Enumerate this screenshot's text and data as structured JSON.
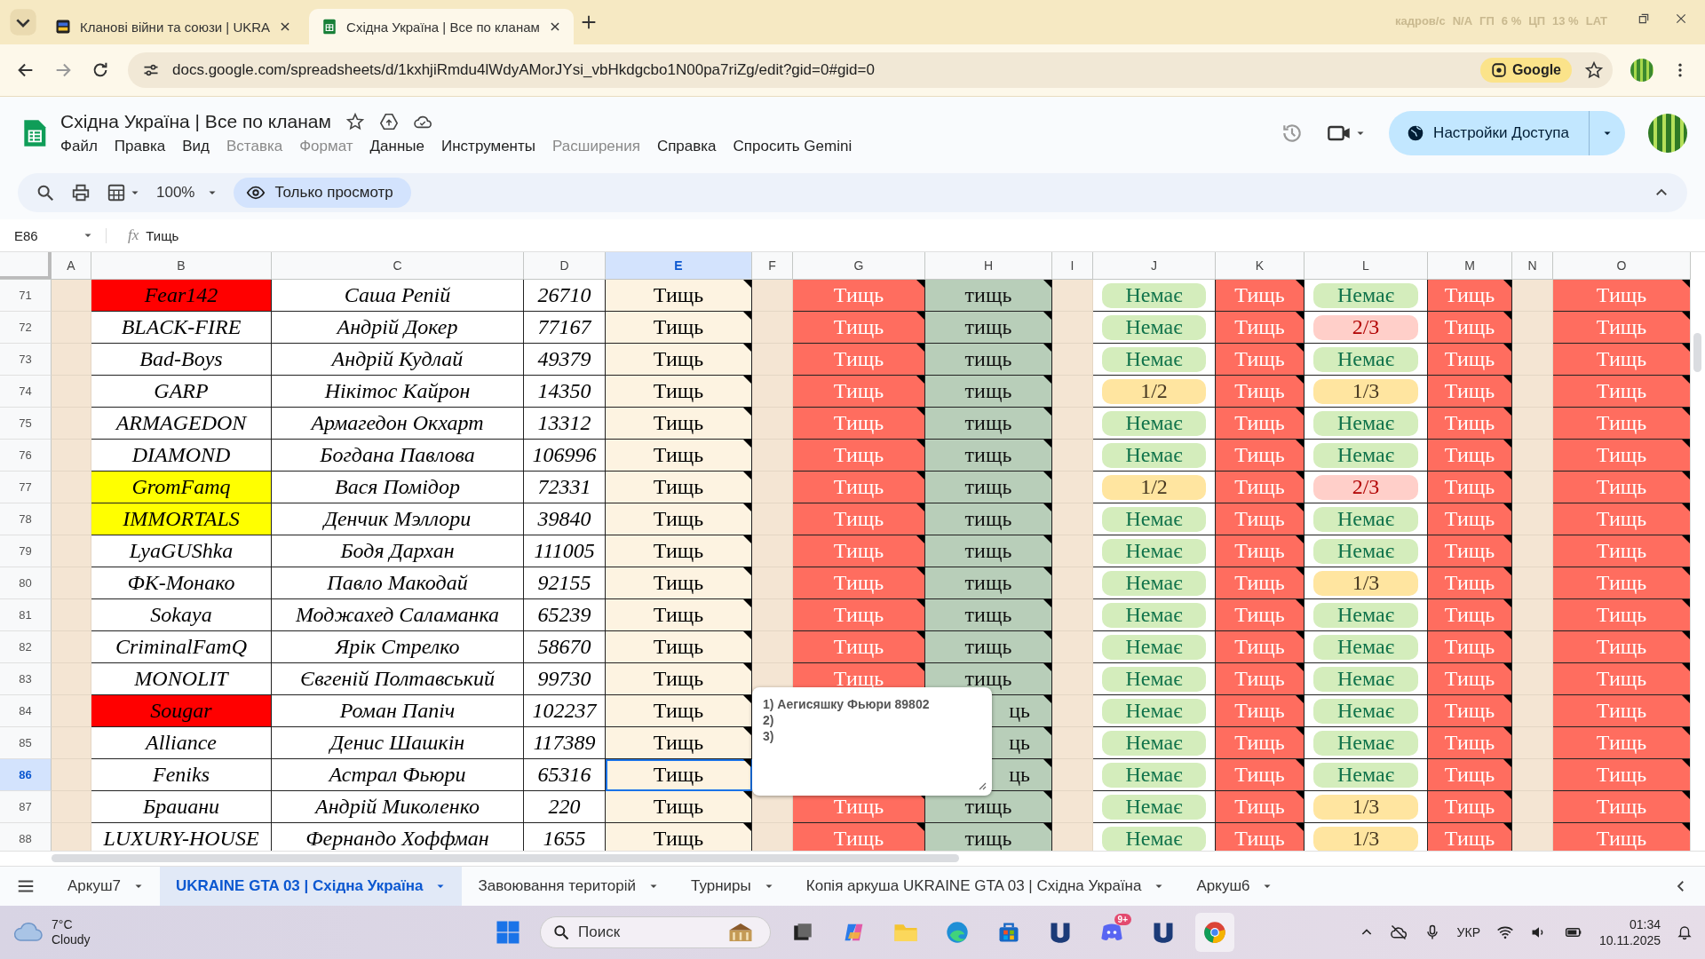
{
  "browser": {
    "tabs": [
      {
        "title": "Кланові війни та союзи | UKRA",
        "selected": false
      },
      {
        "title": "Східна Україна | Все по кланам",
        "selected": true
      }
    ],
    "overlay": [
      "кадров/с",
      "N/A",
      "ГП",
      "6 %",
      "ЦП",
      "13 %",
      "LAT"
    ],
    "url": "docs.google.com/spreadsheets/d/1kxhjiRmdu4lWdyAMorJYsi_vbHkdgcbo1N00pa7riZg/edit?gid=0#gid=0",
    "lens_chip": "Google"
  },
  "document": {
    "title": "Східна Україна | Все по кланам",
    "menus": [
      {
        "label": "Файл",
        "disabled": false
      },
      {
        "label": "Правка",
        "disabled": false
      },
      {
        "label": "Вид",
        "disabled": false
      },
      {
        "label": "Вставка",
        "disabled": true
      },
      {
        "label": "Формат",
        "disabled": true
      },
      {
        "label": "Данные",
        "disabled": false
      },
      {
        "label": "Инструменты",
        "disabled": false
      },
      {
        "label": "Расширения",
        "disabled": true
      },
      {
        "label": "Справка",
        "disabled": false
      },
      {
        "label": "Спросить Gemini",
        "disabled": false
      }
    ],
    "share_button": "Настройки Доступа"
  },
  "toolbar": {
    "zoom": "100%",
    "view_only": "Только просмотр"
  },
  "formula_bar": {
    "cell": "E86",
    "fx_label": "fx",
    "value": "Тищь"
  },
  "columns": [
    {
      "label": "A",
      "selected": false
    },
    {
      "label": "B",
      "selected": false
    },
    {
      "label": "C",
      "selected": false
    },
    {
      "label": "D",
      "selected": false
    },
    {
      "label": "E",
      "selected": true
    },
    {
      "label": "F",
      "selected": false
    },
    {
      "label": "G",
      "selected": false
    },
    {
      "label": "H",
      "selected": false
    },
    {
      "label": "I",
      "selected": false
    },
    {
      "label": "J",
      "selected": false
    },
    {
      "label": "K",
      "selected": false
    },
    {
      "label": "L",
      "selected": false
    },
    {
      "label": "M",
      "selected": false
    },
    {
      "label": "N",
      "selected": false
    },
    {
      "label": "O",
      "selected": false
    }
  ],
  "rows": [
    {
      "num": "71",
      "selected": false,
      "b": {
        "text": "Fear142",
        "color": "#ff0000"
      },
      "c": "Саша Репій",
      "d": "26710",
      "e": "Тищь",
      "g": "Тищь",
      "h": "тищь",
      "j": {
        "text": "Немає",
        "kind": "none"
      },
      "k": "Тищь",
      "l": {
        "text": "Немає",
        "kind": "none"
      },
      "m": "Тищь",
      "o": "Тищь"
    },
    {
      "num": "72",
      "selected": false,
      "b": {
        "text": "BLACK-FIRE"
      },
      "c": "Андрій Докер",
      "d": "77167",
      "e": "Тищь",
      "g": "Тищь",
      "h": "тищь",
      "j": {
        "text": "Немає",
        "kind": "none"
      },
      "k": "Тищь",
      "l": {
        "text": "2/3",
        "kind": "most"
      },
      "m": "Тищь",
      "o": "Тищь"
    },
    {
      "num": "73",
      "selected": false,
      "b": {
        "text": "Bad-Boys"
      },
      "c": "Андрій Кудлай",
      "d": "49379",
      "e": "Тищь",
      "g": "Тищь",
      "h": "тищь",
      "j": {
        "text": "Немає",
        "kind": "none"
      },
      "k": "Тищь",
      "l": {
        "text": "Немає",
        "kind": "none"
      },
      "m": "Тищь",
      "o": "Тищь"
    },
    {
      "num": "74",
      "selected": false,
      "b": {
        "text": "GARP"
      },
      "c": "Нікітос Кайрон",
      "d": "14350",
      "e": "Тищь",
      "g": "Тищь",
      "h": "тищь",
      "j": {
        "text": "1/2",
        "kind": "part"
      },
      "k": "Тищь",
      "l": {
        "text": "1/3",
        "kind": "part"
      },
      "m": "Тищь",
      "o": "Тищь"
    },
    {
      "num": "75",
      "selected": false,
      "b": {
        "text": "ARMAGEDON"
      },
      "c": "Армагедон Окхарт",
      "d": "13312",
      "e": "Тищь",
      "g": "Тищь",
      "h": "тищь",
      "j": {
        "text": "Немає",
        "kind": "none"
      },
      "k": "Тищь",
      "l": {
        "text": "Немає",
        "kind": "none"
      },
      "m": "Тищь",
      "o": "Тищь"
    },
    {
      "num": "76",
      "selected": false,
      "b": {
        "text": "DIAMOND"
      },
      "c": "Богдана Павлова",
      "d": "106996",
      "e": "Тищь",
      "g": "Тищь",
      "h": "тищь",
      "j": {
        "text": "Немає",
        "kind": "none"
      },
      "k": "Тищь",
      "l": {
        "text": "Немає",
        "kind": "none"
      },
      "m": "Тищь",
      "o": "Тищь"
    },
    {
      "num": "77",
      "selected": false,
      "b": {
        "text": "GromFamq",
        "color": "#ffff00"
      },
      "c": "Вася Помідор",
      "d": "72331",
      "e": "Тищь",
      "g": "Тищь",
      "h": "тищь",
      "j": {
        "text": "1/2",
        "kind": "part"
      },
      "k": "Тищь",
      "l": {
        "text": "2/3",
        "kind": "most"
      },
      "m": "Тищь",
      "o": "Тищь"
    },
    {
      "num": "78",
      "selected": false,
      "b": {
        "text": "IMMORTALS",
        "color": "#ffff00"
      },
      "c": "Денчик Мэллори",
      "d": "39840",
      "e": "Тищь",
      "g": "Тищь",
      "h": "тищь",
      "j": {
        "text": "Немає",
        "kind": "none"
      },
      "k": "Тищь",
      "l": {
        "text": "Немає",
        "kind": "none"
      },
      "m": "Тищь",
      "o": "Тищь"
    },
    {
      "num": "79",
      "selected": false,
      "b": {
        "text": "LyaGUShka"
      },
      "c": "Бодя Дархан",
      "d": "111005",
      "e": "Тищь",
      "g": "Тищь",
      "h": "тищь",
      "j": {
        "text": "Немає",
        "kind": "none"
      },
      "k": "Тищь",
      "l": {
        "text": "Немає",
        "kind": "none"
      },
      "m": "Тищь",
      "o": "Тищь"
    },
    {
      "num": "80",
      "selected": false,
      "b": {
        "text": "ФК-Монако"
      },
      "c": "Павло Макодай",
      "d": "92155",
      "e": "Тищь",
      "g": "Тищь",
      "h": "тищь",
      "j": {
        "text": "Немає",
        "kind": "none"
      },
      "k": "Тищь",
      "l": {
        "text": "1/3",
        "kind": "part"
      },
      "m": "Тищь",
      "o": "Тищь"
    },
    {
      "num": "81",
      "selected": false,
      "b": {
        "text": "Sokaya"
      },
      "c": "Моджахед Саламанка",
      "d": "65239",
      "e": "Тищь",
      "g": "Тищь",
      "h": "тищь",
      "j": {
        "text": "Немає",
        "kind": "none"
      },
      "k": "Тищь",
      "l": {
        "text": "Немає",
        "kind": "none"
      },
      "m": "Тищь",
      "o": "Тищь"
    },
    {
      "num": "82",
      "selected": false,
      "b": {
        "text": "CriminalFamQ"
      },
      "c": "Ярік Стрелко",
      "d": "58670",
      "e": "Тищь",
      "g": "Тищь",
      "h": "тищь",
      "j": {
        "text": "Немає",
        "kind": "none"
      },
      "k": "Тищь",
      "l": {
        "text": "Немає",
        "kind": "none"
      },
      "m": "Тищь",
      "o": "Тищь"
    },
    {
      "num": "83",
      "selected": false,
      "b": {
        "text": "MONOLIT"
      },
      "c": "Євгеній Полтавський",
      "d": "99730",
      "e": "Тищь",
      "g": "Тищь",
      "h": "тищь",
      "j": {
        "text": "Немає",
        "kind": "none"
      },
      "k": "Тищь",
      "l": {
        "text": "Немає",
        "kind": "none"
      },
      "m": "Тищь",
      "o": "Тищь"
    },
    {
      "num": "84",
      "selected": false,
      "b": {
        "text": "Sougar",
        "color": "#ff0000"
      },
      "c": "Роман Папіч",
      "d": "102237",
      "e": "Тищь",
      "h": "ць",
      "j": {
        "text": "Немає",
        "kind": "none"
      },
      "k": "Тищь",
      "l": {
        "text": "Немає",
        "kind": "none"
      },
      "m": "Тищь",
      "o": "Тищь"
    },
    {
      "num": "85",
      "selected": false,
      "b": {
        "text": "Alliance"
      },
      "c": "Денис Шашкін",
      "d": "117389",
      "e": "Тищь",
      "h": "ць",
      "j": {
        "text": "Немає",
        "kind": "none"
      },
      "k": "Тищь",
      "l": {
        "text": "Немає",
        "kind": "none"
      },
      "m": "Тищь",
      "o": "Тищь"
    },
    {
      "num": "86",
      "selected": true,
      "b": {
        "text": "Feniks"
      },
      "c": "Астрал Фьюри",
      "d": "65316",
      "e": "Тищь",
      "h": "ць",
      "j": {
        "text": "Немає",
        "kind": "none"
      },
      "k": "Тищь",
      "l": {
        "text": "Немає",
        "kind": "none"
      },
      "m": "Тищь",
      "o": "Тищь"
    },
    {
      "num": "87",
      "selected": false,
      "b": {
        "text": "Браиани"
      },
      "c": "Андрій Миколенко",
      "d": "220",
      "e": "Тищь",
      "g": "Тищь",
      "h": "тищь",
      "j": {
        "text": "Немає",
        "kind": "none"
      },
      "k": "Тищь",
      "l": {
        "text": "1/3",
        "kind": "part"
      },
      "m": "Тищь",
      "o": "Тищь"
    },
    {
      "num": "88",
      "selected": false,
      "b": {
        "text": "LUXURY-HOUSE"
      },
      "c": "Фернандо Хоффман",
      "d": "1655",
      "e": "Тищь",
      "g": "Тищь",
      "h": "тищь",
      "j": {
        "text": "Немає",
        "kind": "none"
      },
      "k": "Тищь",
      "l": {
        "text": "1/3",
        "kind": "part"
      },
      "m": "Тищь",
      "o": "Тищь"
    }
  ],
  "comment": {
    "lines": [
      "1) Аегисяшку Фьюри 89802",
      "2)",
      "3)"
    ]
  },
  "sheet_tabs": [
    {
      "label": "Аркуш7",
      "selected": false
    },
    {
      "label": "UKRAINE GTA 03 | Східна Україна",
      "selected": true
    },
    {
      "label": "Завоювання територій",
      "selected": false
    },
    {
      "label": "Турниры",
      "selected": false
    },
    {
      "label": "Копія аркуша UKRAINE GTA 03 | Східна Україна",
      "selected": false
    },
    {
      "label": "Аркуш6",
      "selected": false
    }
  ],
  "taskbar": {
    "temperature": "7°C",
    "condition": "Cloudy",
    "search_placeholder": "Поиск",
    "discord_badge": "9+",
    "language": "УКР",
    "time": "01:34",
    "date": "10.11.2025"
  }
}
